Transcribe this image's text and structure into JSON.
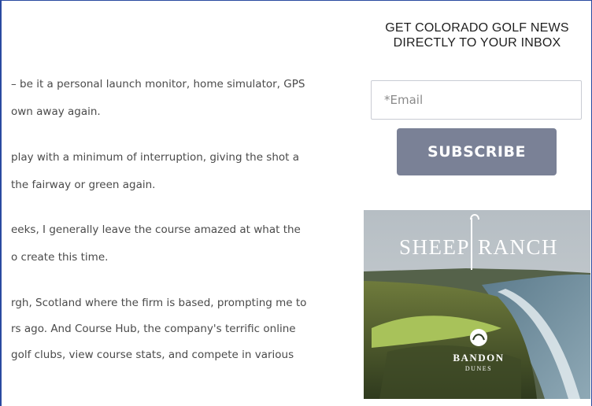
{
  "article": {
    "lines": [
      "– be it a personal launch monitor, home simulator, GPS",
      "own away again.",
      "play with a minimum of interruption, giving the shot a",
      "the fairway or green again.",
      "eeks, I generally leave the course amazed at what the",
      "o create this time.",
      "rgh, Scotland where the firm is based, prompting me to",
      "rs ago. And Course Hub, the company's terrific online",
      "golf clubs, view course stats, and compete in various"
    ]
  },
  "sidebar": {
    "heading_line1": "GET COLORADO GOLF NEWS",
    "heading_line2": "DIRECTLY TO YOUR INBOX",
    "email_placeholder": "*Email",
    "subscribe_label": "SUBSCRIBE"
  },
  "ad": {
    "left_word": "SHEEP",
    "right_word": "RANCH",
    "brand_top": "BANDON",
    "brand_bottom": "DUNES"
  },
  "colors": {
    "button": "#7a8196",
    "frame": "#2a4aa0",
    "text": "#4a4a4a"
  }
}
